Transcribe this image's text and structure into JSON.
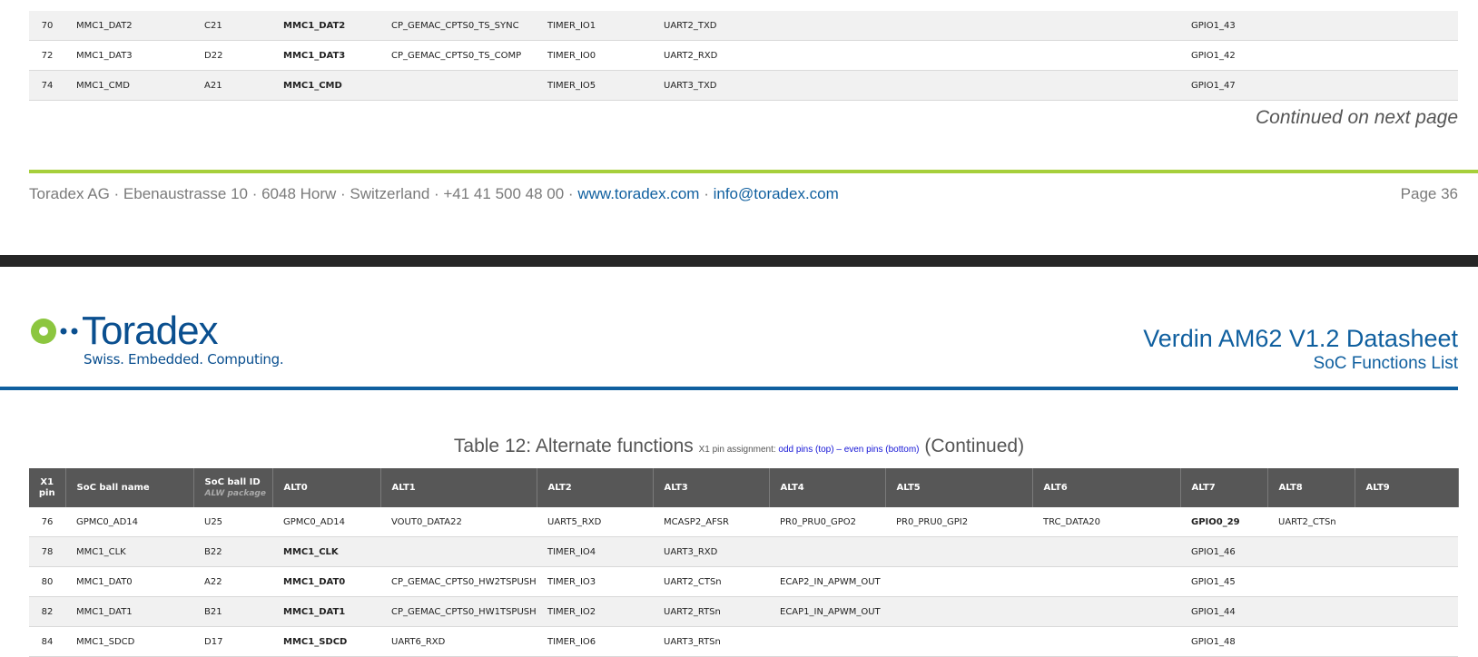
{
  "top_rows": [
    {
      "pin": "70",
      "ball_name": "MMC1_DAT2",
      "ball_id": "C21",
      "alt0": "MMC1_DAT2",
      "alt0_bold": true,
      "alt1": "CP_GEMAC_CPTS0_TS_SYNC",
      "alt2": "TIMER_IO1",
      "alt3": "UART2_TXD",
      "alt4": "",
      "alt5": "",
      "alt6": "",
      "alt7": "GPIO1_43",
      "alt7_bold": false,
      "alt8": "",
      "alt9": ""
    },
    {
      "pin": "72",
      "ball_name": "MMC1_DAT3",
      "ball_id": "D22",
      "alt0": "MMC1_DAT3",
      "alt0_bold": true,
      "alt1": "CP_GEMAC_CPTS0_TS_COMP",
      "alt2": "TIMER_IO0",
      "alt3": "UART2_RXD",
      "alt4": "",
      "alt5": "",
      "alt6": "",
      "alt7": "GPIO1_42",
      "alt7_bold": false,
      "alt8": "",
      "alt9": ""
    },
    {
      "pin": "74",
      "ball_name": "MMC1_CMD",
      "ball_id": "A21",
      "alt0": "MMC1_CMD",
      "alt0_bold": true,
      "alt1": "",
      "alt2": "TIMER_IO5",
      "alt3": "UART3_TXD",
      "alt4": "",
      "alt5": "",
      "alt6": "",
      "alt7": "GPIO1_47",
      "alt7_bold": false,
      "alt8": "",
      "alt9": ""
    }
  ],
  "continued_next": "Continued on next page",
  "footer": {
    "address": "Toradex AG · Ebenaustrasse 10 · 6048 Horw · Switzerland · +41 41 500 48 00 · ",
    "website": "www.toradex.com",
    "sep": " · ",
    "email": "info@toradex.com",
    "page": "Page 36"
  },
  "header": {
    "logo_word": "Toradex",
    "logo_tagline": "Swiss. Embedded. Computing.",
    "title": "Verdin AM62 V1.2 Datasheet",
    "subtitle": "SoC Functions List"
  },
  "caption": {
    "main": "Table 12:  Alternate functions ",
    "small_prefix": "X1 pin assignment: ",
    "small_link": "odd pins (top) – even pins (bottom)",
    "suffix": " (Continued)"
  },
  "columns": {
    "pin": "X1 pin",
    "ball_name": "SoC ball name",
    "ball_id": "SoC ball ID",
    "ball_id_sub": "ALW package",
    "alt0": "ALT0",
    "alt1": "ALT1",
    "alt2": "ALT2",
    "alt3": "ALT3",
    "alt4": "ALT4",
    "alt5": "ALT5",
    "alt6": "ALT6",
    "alt7": "ALT7",
    "alt8": "ALT8",
    "alt9": "ALT9"
  },
  "bottom_rows": [
    {
      "pin": "76",
      "ball_name": "GPMC0_AD14",
      "ball_id": "U25",
      "alt0": "GPMC0_AD14",
      "alt0_bold": false,
      "alt1": "VOUT0_DATA22",
      "alt2": "UART5_RXD",
      "alt3": "MCASP2_AFSR",
      "alt4": "PR0_PRU0_GPO2",
      "alt5": "PR0_PRU0_GPI2",
      "alt6": "TRC_DATA20",
      "alt7": "GPIO0_29",
      "alt7_bold": true,
      "alt8": "UART2_CTSn",
      "alt9": ""
    },
    {
      "pin": "78",
      "ball_name": "MMC1_CLK",
      "ball_id": "B22",
      "alt0": "MMC1_CLK",
      "alt0_bold": true,
      "alt1": "",
      "alt2": "TIMER_IO4",
      "alt3": "UART3_RXD",
      "alt4": "",
      "alt5": "",
      "alt6": "",
      "alt7": "GPIO1_46",
      "alt7_bold": false,
      "alt8": "",
      "alt9": ""
    },
    {
      "pin": "80",
      "ball_name": "MMC1_DAT0",
      "ball_id": "A22",
      "alt0": "MMC1_DAT0",
      "alt0_bold": true,
      "alt1": "CP_GEMAC_CPTS0_HW2TSPUSH",
      "alt2": "TIMER_IO3",
      "alt3": "UART2_CTSn",
      "alt4": "ECAP2_IN_APWM_OUT",
      "alt5": "",
      "alt6": "",
      "alt7": "GPIO1_45",
      "alt7_bold": false,
      "alt8": "",
      "alt9": ""
    },
    {
      "pin": "82",
      "ball_name": "MMC1_DAT1",
      "ball_id": "B21",
      "alt0": "MMC1_DAT1",
      "alt0_bold": true,
      "alt1": "CP_GEMAC_CPTS0_HW1TSPUSH",
      "alt2": "TIMER_IO2",
      "alt3": "UART2_RTSn",
      "alt4": "ECAP1_IN_APWM_OUT",
      "alt5": "",
      "alt6": "",
      "alt7": "GPIO1_44",
      "alt7_bold": false,
      "alt8": "",
      "alt9": ""
    },
    {
      "pin": "84",
      "ball_name": "MMC1_SDCD",
      "ball_id": "D17",
      "alt0": "MMC1_SDCD",
      "alt0_bold": true,
      "alt1": "UART6_RXD",
      "alt2": "TIMER_IO6",
      "alt3": "UART3_RTSn",
      "alt4": "",
      "alt5": "",
      "alt6": "",
      "alt7": "GPIO1_48",
      "alt7_bold": false,
      "alt8": "",
      "alt9": ""
    }
  ],
  "colors": {
    "green_rule": "#a6cf3b",
    "blue_brand": "#0f5f9f",
    "header_bg": "#575757",
    "dark_bar": "#262626"
  }
}
